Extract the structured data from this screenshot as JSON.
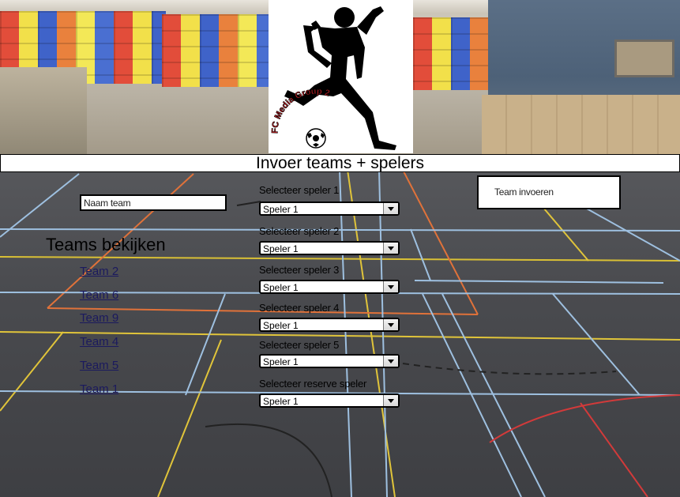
{
  "header": {
    "title": "Invoer teams + spelers"
  },
  "logo": {
    "text": "FC Media Group 2"
  },
  "form": {
    "team_name_placeholder": "Naam team",
    "submit_label": "Team invoeren",
    "players": [
      {
        "label": "Selecteer speler 1",
        "value": "Speler 1"
      },
      {
        "label": "Selecteer speler 2",
        "value": "Speler 1"
      },
      {
        "label": "Selecteer speler 3",
        "value": "Speler 1"
      },
      {
        "label": "Selecteer speler 4",
        "value": "Speler 1"
      },
      {
        "label": "Selecteer speler 5",
        "value": "Speler 1"
      },
      {
        "label": "Selecteer reserve speler",
        "value": "Speler 1"
      }
    ]
  },
  "teams": {
    "title": "Teams bekijken",
    "links": [
      "Team 2",
      "Team 6",
      "Team 9",
      "Team 4",
      "Team 5",
      "Team 1"
    ]
  }
}
